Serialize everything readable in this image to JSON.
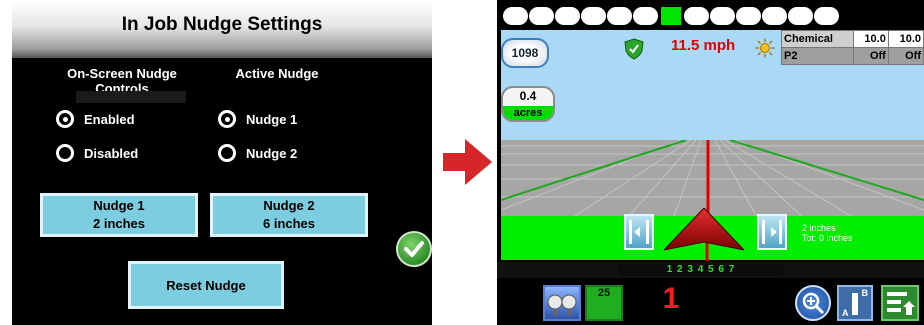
{
  "left": {
    "title": "In Job Nudge Settings",
    "onscreen_header_line1": "On-Screen Nudge",
    "onscreen_header_line2": "Controls",
    "active_header": "Active Nudge",
    "options_onscreen": [
      "Enabled",
      "Disabled"
    ],
    "selected_onscreen": "Enabled",
    "options_active": [
      "Nudge 1",
      "Nudge 2"
    ],
    "selected_active": "Nudge 1",
    "nudge1": {
      "label": "Nudge 1",
      "value": "2 inches"
    },
    "nudge2": {
      "label": "Nudge 2",
      "value": "6 inches"
    },
    "reset_label": "Reset Nudge",
    "confirm_icon": "check-icon"
  },
  "right": {
    "section_count": 13,
    "active_section": 7,
    "count_badge": "1098",
    "area_value": "0.4",
    "area_unit": "acres",
    "speed": "11.5 mph",
    "products": [
      {
        "name": "Chemical",
        "target": "10.0",
        "actual": "10.0"
      },
      {
        "name": "P2",
        "target": "Off",
        "actual": "Off"
      }
    ],
    "nudge_info_line1": "2 inches",
    "nudge_info_line2": "Tot: 0 inches",
    "section_numbers": "1 2 3 4 5 6 7",
    "rate_button_value": "25",
    "big_number": "1",
    "ab_label_a": "A",
    "ab_label_b": "B",
    "colors": {
      "accent_green": "#00ee00",
      "speed_red": "#e00000",
      "button_blue": "#7dcde0"
    }
  }
}
